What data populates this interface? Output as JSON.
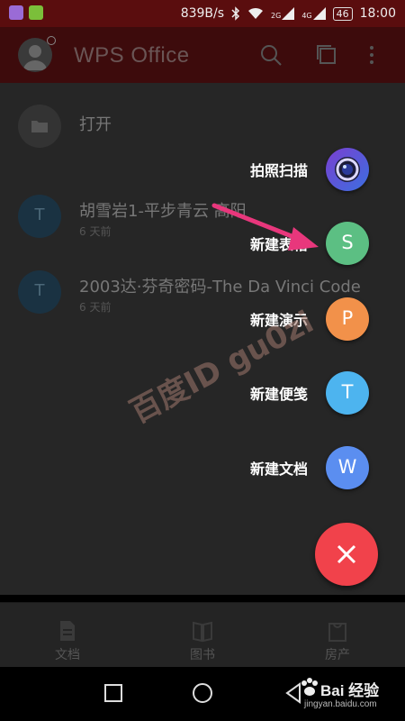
{
  "status_bar": {
    "speed": "839B/s",
    "net_2g": "2G",
    "net_4g": "4G",
    "battery": "46",
    "time": "18:00"
  },
  "app_bar": {
    "title": "WPS Office",
    "icons": [
      "search-icon",
      "multi-window-icon",
      "more-vert-icon"
    ]
  },
  "list": {
    "open_label": "打开",
    "files": [
      {
        "letter": "T",
        "name": "胡雪岩1-平步青云 高阳",
        "meta": "6 天前"
      },
      {
        "letter": "T",
        "name": "2003达·芬奇密码-The Da Vinci Code",
        "meta": "6 天前"
      }
    ]
  },
  "fab_menu": {
    "items": [
      {
        "label": "拍照扫描",
        "letter": "",
        "color": "#4a5bd8"
      },
      {
        "label": "新建表格",
        "letter": "S",
        "color": "#5cbf83"
      },
      {
        "label": "新建演示",
        "letter": "P",
        "color": "#f2914a"
      },
      {
        "label": "新建便笺",
        "letter": "T",
        "color": "#4db4ef"
      },
      {
        "label": "新建文档",
        "letter": "W",
        "color": "#5b8ef0"
      }
    ],
    "close_color": "#f1424b"
  },
  "bottom_nav": {
    "tabs": [
      {
        "label": "文档"
      },
      {
        "label": "图书"
      },
      {
        "label": "房产"
      }
    ]
  },
  "watermark": {
    "text": "百度ID gu0zi",
    "brand": "Bai 经验",
    "site": "jingyan.baidu.com"
  },
  "arrow_color": "#e8377c"
}
